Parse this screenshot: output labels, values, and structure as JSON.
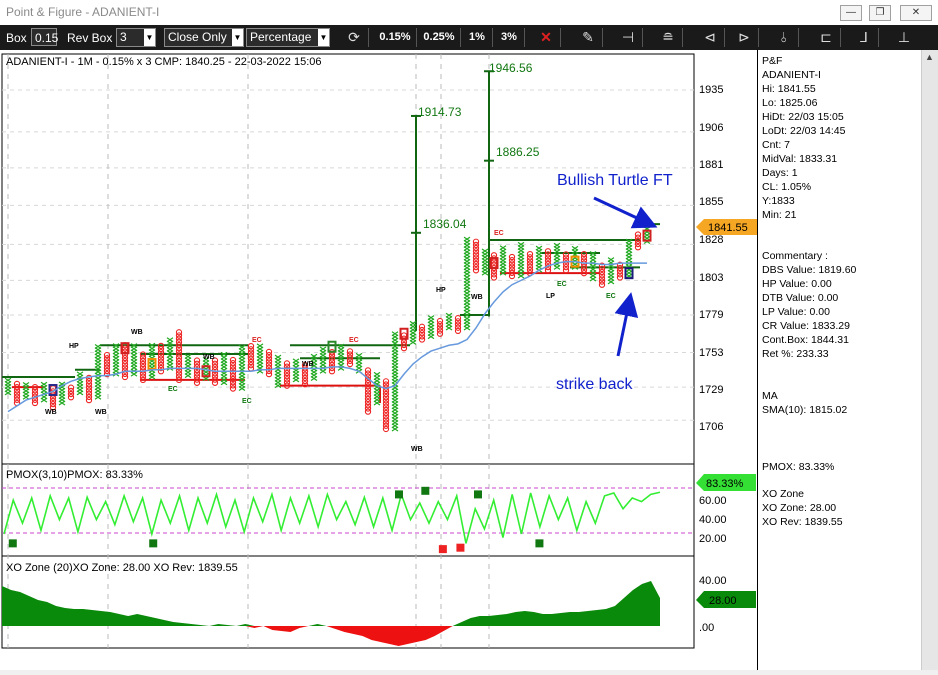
{
  "window": {
    "title": "Point & Figure - ADANIENT-I"
  },
  "toolbar": {
    "box_label": "Box",
    "box_value": "0.15",
    "revbox_label": "Rev Box",
    "revbox_value": "3",
    "price_mode": "Close Only",
    "box_type": "Percentage",
    "presets": [
      "0.15%",
      "0.25%",
      "1%",
      "3%"
    ]
  },
  "main_chart": {
    "header": "ADANIENT-I - 1M - 0.15% x 3 CMP: 1840.25 - 22-03-2022 15:06",
    "yticks": [
      "1935",
      "1906",
      "1881",
      "1855",
      "1828",
      "1803",
      "1779",
      "1753",
      "1729",
      "1706"
    ],
    "current_price": "1841.55",
    "annotations": {
      "bullish": "Bullish Turtle FT",
      "strike": "strike back",
      "target_1946": "1946.56",
      "target_1914": "1914.73",
      "target_1886": "1886.25",
      "target_1836": "1836.04"
    },
    "pattern_labels": {
      "hp1": "HP",
      "wb1": "WB",
      "wb2": "WB",
      "wb3": "WB",
      "wb4": "WB",
      "wb5": "WB",
      "wb6": "WB",
      "wb7": "WB",
      "ec1": "EC",
      "ec2": "EC",
      "ec3": "EC",
      "ec4": "EC",
      "ec5": "EC",
      "ec6": "EC",
      "ec7": "EC",
      "hp2": "HP",
      "lp1": "LP"
    }
  },
  "pmox_panel": {
    "header": "PMOX(3,10)PMOX: 83.33%",
    "yticks": [
      "60.00",
      "40.00",
      "20.00"
    ],
    "value": "83.33%"
  },
  "xo_panel": {
    "header": "XO Zone (20)XO Zone: 28.00 XO Rev: 1839.55",
    "yticks": [
      "40.00",
      ".00"
    ],
    "value": "28.00"
  },
  "side_panel": {
    "lines": [
      "P&F",
      "ADANIENT-I",
      "Hi: 1841.55",
      "Lo: 1825.06",
      "HiDt: 22/03 15:05",
      "LoDt: 22/03 14:45",
      "Cnt: 7",
      "MidVal: 1833.31",
      "Days: 1",
      "CL: 1.05%",
      "Y:1833",
      "Min: 21"
    ],
    "commentary": [
      "Commentary :",
      "DBS Value:  1819.60",
      "HP Value: 0.00",
      "DTB Value: 0.00",
      "LP Value: 0.00",
      "CR Value: 1833.29",
      "Cont.Box: 1844.31",
      "Ret %: 233.33"
    ],
    "ma": [
      "MA",
      "SMA(10): 1815.02"
    ],
    "pmox": [
      "PMOX: 83.33%"
    ],
    "xo": [
      "XO Zone",
      "XO Zone: 28.00",
      "XO Rev: 1839.55"
    ]
  },
  "chart_data": [
    {
      "type": "point_and_figure",
      "symbol": "ADANIENT-I",
      "box_size_pct": 0.15,
      "reversal": 3,
      "ylim": [
        1690,
        1950
      ],
      "ma_name": "SMA(10)",
      "colors": {
        "x": "#22aa22",
        "o": "#ee2222",
        "ma": "#6699dd",
        "resistance": "#116611",
        "support": "#dd1111",
        "arrow": "#1122cc"
      },
      "columns": [
        {
          "c": 0,
          "t": "X",
          "lo": 1725,
          "hi": 1736
        },
        {
          "c": 1,
          "t": "O",
          "lo": 1718,
          "hi": 1733
        },
        {
          "c": 2,
          "t": "X",
          "lo": 1722,
          "hi": 1733
        },
        {
          "c": 3,
          "t": "O",
          "lo": 1718,
          "hi": 1730
        },
        {
          "c": 4,
          "t": "X",
          "lo": 1720,
          "hi": 1733
        },
        {
          "c": 5,
          "t": "O",
          "lo": 1715,
          "hi": 1730
        },
        {
          "c": 6,
          "t": "X",
          "lo": 1718,
          "hi": 1733
        },
        {
          "c": 7,
          "t": "O",
          "lo": 1722,
          "hi": 1730
        },
        {
          "c": 8,
          "t": "X",
          "lo": 1725,
          "hi": 1740
        },
        {
          "c": 9,
          "t": "O",
          "lo": 1720,
          "hi": 1736
        },
        {
          "c": 10,
          "t": "X",
          "lo": 1722,
          "hi": 1758
        },
        {
          "c": 11,
          "t": "O",
          "lo": 1738,
          "hi": 1752
        },
        {
          "c": 12,
          "t": "X",
          "lo": 1738,
          "hi": 1758
        },
        {
          "c": 13,
          "t": "O",
          "lo": 1736,
          "hi": 1760
        },
        {
          "c": 14,
          "t": "X",
          "lo": 1738,
          "hi": 1760
        },
        {
          "c": 15,
          "t": "O",
          "lo": 1734,
          "hi": 1752
        },
        {
          "c": 16,
          "t": "X",
          "lo": 1736,
          "hi": 1760
        },
        {
          "c": 17,
          "t": "O",
          "lo": 1740,
          "hi": 1758
        },
        {
          "c": 18,
          "t": "X",
          "lo": 1742,
          "hi": 1762
        },
        {
          "c": 19,
          "t": "O",
          "lo": 1734,
          "hi": 1768
        },
        {
          "c": 20,
          "t": "X",
          "lo": 1737,
          "hi": 1752
        },
        {
          "c": 21,
          "t": "O",
          "lo": 1732,
          "hi": 1748
        },
        {
          "c": 22,
          "t": "X",
          "lo": 1735,
          "hi": 1750
        },
        {
          "c": 23,
          "t": "O",
          "lo": 1732,
          "hi": 1748
        },
        {
          "c": 24,
          "t": "X",
          "lo": 1732,
          "hi": 1752
        },
        {
          "c": 25,
          "t": "O",
          "lo": 1728,
          "hi": 1750
        },
        {
          "c": 26,
          "t": "X",
          "lo": 1728,
          "hi": 1758
        },
        {
          "c": 27,
          "t": "O",
          "lo": 1742,
          "hi": 1758
        },
        {
          "c": 28,
          "t": "X",
          "lo": 1740,
          "hi": 1758
        },
        {
          "c": 29,
          "t": "O",
          "lo": 1738,
          "hi": 1755
        },
        {
          "c": 30,
          "t": "X",
          "lo": 1730,
          "hi": 1750
        },
        {
          "c": 31,
          "t": "O",
          "lo": 1730,
          "hi": 1746
        },
        {
          "c": 32,
          "t": "X",
          "lo": 1734,
          "hi": 1749
        },
        {
          "c": 33,
          "t": "O",
          "lo": 1731,
          "hi": 1745
        },
        {
          "c": 34,
          "t": "X",
          "lo": 1735,
          "hi": 1752
        },
        {
          "c": 35,
          "t": "X",
          "lo": 1740,
          "hi": 1756
        },
        {
          "c": 36,
          "t": "O",
          "lo": 1740,
          "hi": 1755
        },
        {
          "c": 37,
          "t": "X",
          "lo": 1742,
          "hi": 1758
        },
        {
          "c": 38,
          "t": "O",
          "lo": 1745,
          "hi": 1755
        },
        {
          "c": 39,
          "t": "X",
          "lo": 1740,
          "hi": 1752
        },
        {
          "c": 40,
          "t": "O",
          "lo": 1712,
          "hi": 1742
        },
        {
          "c": 41,
          "t": "X",
          "lo": 1718,
          "hi": 1740
        },
        {
          "c": 42,
          "t": "O",
          "lo": 1700,
          "hi": 1735
        },
        {
          "c": 43,
          "t": "X",
          "lo": 1700,
          "hi": 1768
        },
        {
          "c": 44,
          "t": "O",
          "lo": 1756,
          "hi": 1766
        },
        {
          "c": 45,
          "t": "X",
          "lo": 1760,
          "hi": 1774
        },
        {
          "c": 46,
          "t": "O",
          "lo": 1762,
          "hi": 1772
        },
        {
          "c": 47,
          "t": "X",
          "lo": 1764,
          "hi": 1778
        },
        {
          "c": 48,
          "t": "O",
          "lo": 1766,
          "hi": 1776
        },
        {
          "c": 49,
          "t": "X",
          "lo": 1770,
          "hi": 1780
        },
        {
          "c": 50,
          "t": "O",
          "lo": 1768,
          "hi": 1778
        },
        {
          "c": 51,
          "t": "X",
          "lo": 1770,
          "hi": 1833
        },
        {
          "c": 52,
          "t": "O",
          "lo": 1810,
          "hi": 1830
        },
        {
          "c": 53,
          "t": "X",
          "lo": 1808,
          "hi": 1825
        },
        {
          "c": 54,
          "t": "O",
          "lo": 1805,
          "hi": 1822
        },
        {
          "c": 55,
          "t": "X",
          "lo": 1808,
          "hi": 1826
        },
        {
          "c": 56,
          "t": "O",
          "lo": 1806,
          "hi": 1820
        },
        {
          "c": 57,
          "t": "X",
          "lo": 1806,
          "hi": 1830
        },
        {
          "c": 58,
          "t": "O",
          "lo": 1808,
          "hi": 1822
        },
        {
          "c": 59,
          "t": "X",
          "lo": 1810,
          "hi": 1826
        },
        {
          "c": 60,
          "t": "O",
          "lo": 1810,
          "hi": 1825
        },
        {
          "c": 61,
          "t": "X",
          "lo": 1812,
          "hi": 1828
        },
        {
          "c": 62,
          "t": "O",
          "lo": 1810,
          "hi": 1822
        },
        {
          "c": 63,
          "t": "X",
          "lo": 1812,
          "hi": 1826
        },
        {
          "c": 64,
          "t": "O",
          "lo": 1808,
          "hi": 1822
        },
        {
          "c": 65,
          "t": "X",
          "lo": 1804,
          "hi": 1822
        },
        {
          "c": 66,
          "t": "O",
          "lo": 1800,
          "hi": 1815
        },
        {
          "c": 67,
          "t": "X",
          "lo": 1802,
          "hi": 1818
        },
        {
          "c": 68,
          "t": "O",
          "lo": 1805,
          "hi": 1815
        },
        {
          "c": 69,
          "t": "X",
          "lo": 1806,
          "hi": 1832
        },
        {
          "c": 70,
          "t": "O",
          "lo": 1826,
          "hi": 1836
        },
        {
          "c": 71,
          "t": "X",
          "lo": 1830,
          "hi": 1842
        }
      ],
      "ma": [
        1712,
        1716,
        1720,
        1722,
        1724,
        1726,
        1730,
        1733,
        1735,
        1736,
        1737,
        1737,
        1738,
        1740,
        1740,
        1740,
        1741,
        1741,
        1742,
        1742,
        1742,
        1742,
        1741,
        1740,
        1740,
        1740,
        1740,
        1740,
        1741,
        1741,
        1742,
        1742,
        1742,
        1742,
        1742,
        1742,
        1743,
        1743,
        1742,
        1740,
        1735,
        1730,
        1728,
        1730,
        1738,
        1745,
        1750,
        1754,
        1756,
        1758,
        1759,
        1762,
        1770,
        1780,
        1788,
        1795,
        1800,
        1803,
        1806,
        1810,
        1813,
        1815,
        1816,
        1816,
        1815,
        1815,
        1814,
        1814,
        1815,
        1815,
        1815,
        1815
      ]
    },
    {
      "type": "line",
      "name": "PMOX(3,10)",
      "ylim": [
        0,
        100
      ],
      "values": [
        25,
        72,
        40,
        75,
        30,
        78,
        45,
        75,
        28,
        76,
        45,
        70,
        38,
        78,
        42,
        75,
        25,
        72,
        40,
        78,
        30,
        75,
        40,
        80,
        35,
        72,
        28,
        75,
        42,
        80,
        30,
        75,
        40,
        78,
        35,
        80,
        45,
        70,
        38,
        76,
        35,
        75,
        30,
        80,
        45,
        68,
        40,
        70,
        45,
        78,
        12,
        60,
        32,
        72,
        20,
        80,
        25,
        82,
        35,
        78,
        45,
        75,
        30,
        70,
        40,
        78,
        82,
        60,
        75,
        70,
        80,
        83
      ]
    },
    {
      "type": "area",
      "name": "XO Zone (20)",
      "ylim": [
        -25,
        60
      ],
      "values": [
        40,
        36,
        34,
        30,
        26,
        24,
        20,
        18,
        17,
        17,
        16,
        15,
        14,
        12,
        10,
        12,
        10,
        8,
        6,
        4,
        3,
        2,
        1,
        0,
        2,
        1,
        0,
        2,
        -2,
        0,
        -4,
        -5,
        -6,
        -2,
        0,
        2,
        0,
        -3,
        -6,
        -8,
        -10,
        -14,
        -16,
        -18,
        -20,
        -18,
        -16,
        -14,
        -10,
        -5,
        0,
        4,
        8,
        10,
        10,
        11,
        12,
        14,
        15,
        14,
        12,
        12,
        13,
        14,
        14,
        15,
        16,
        17,
        20,
        28,
        36,
        42,
        45,
        28
      ]
    }
  ]
}
